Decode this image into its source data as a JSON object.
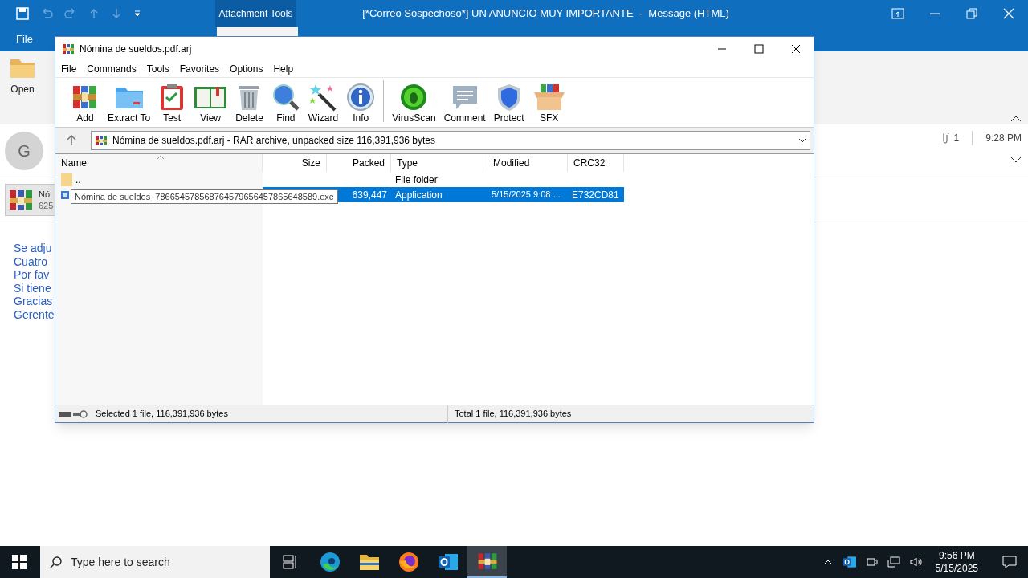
{
  "outlook": {
    "title": "[*Correo Sospechoso*] UN ANUNCIO MUY IMPORTANTE  -  Message (HTML)",
    "context_tab": "Attachment Tools",
    "ribbon_tabs": [
      "File"
    ],
    "ribbon_buttons": [
      "Open"
    ],
    "sender_initial": "G",
    "attachment_count": "1",
    "time": "9:28 PM",
    "attachment": {
      "name": "Nó",
      "size": "625"
    },
    "body_lines": [
      "Se adju",
      "Cuatro",
      "Por fav",
      "Si tiene",
      "Gracias",
      "Gerente"
    ]
  },
  "winrar": {
    "title": "Nómina de sueldos.pdf.arj",
    "menu": [
      "File",
      "Commands",
      "Tools",
      "Favorites",
      "Options",
      "Help"
    ],
    "toolbar": [
      {
        "kind": "add",
        "label": "Add"
      },
      {
        "kind": "extract",
        "label": "Extract To"
      },
      {
        "kind": "test",
        "label": "Test"
      },
      {
        "kind": "view",
        "label": "View"
      },
      {
        "kind": "delete",
        "label": "Delete"
      },
      {
        "kind": "find",
        "label": "Find"
      },
      {
        "kind": "wizard",
        "label": "Wizard"
      },
      {
        "kind": "info",
        "label": "Info"
      },
      {
        "kind": "virusscan",
        "label": "VirusScan"
      },
      {
        "kind": "comment",
        "label": "Comment"
      },
      {
        "kind": "protect",
        "label": "Protect"
      },
      {
        "kind": "sfx",
        "label": "SFX"
      }
    ],
    "address": "Nómina de sueldos.pdf.arj - RAR archive, unpacked size 116,391,936 bytes",
    "columns": [
      "Name",
      "Size",
      "Packed",
      "Type",
      "Modified",
      "CRC32"
    ],
    "rows": [
      {
        "kind": "folder",
        "name": "..",
        "type": "File folder",
        "selected": false
      },
      {
        "kind": "file",
        "packed": "639,447",
        "type": "Application",
        "modified": "5/15/2025 9:08 ...",
        "crc32": "E732CD81",
        "selected": true
      }
    ],
    "tooltip": "Nómina de sueldos_786654578568764579656457865648589.exe",
    "status_left": "Selected 1 file, 116,391,936 bytes",
    "status_right": "Total 1 file, 116,391,936 bytes"
  },
  "taskbar": {
    "search_placeholder": "Type here to search",
    "apps": [
      {
        "kind": "taskview",
        "selected": false
      },
      {
        "kind": "edge",
        "selected": false
      },
      {
        "kind": "explorer",
        "selected": false
      },
      {
        "kind": "firefox",
        "selected": false
      },
      {
        "kind": "outlook",
        "selected": false
      },
      {
        "kind": "winrar",
        "selected": true
      }
    ],
    "time": "9:56 PM",
    "date": "5/15/2025"
  }
}
